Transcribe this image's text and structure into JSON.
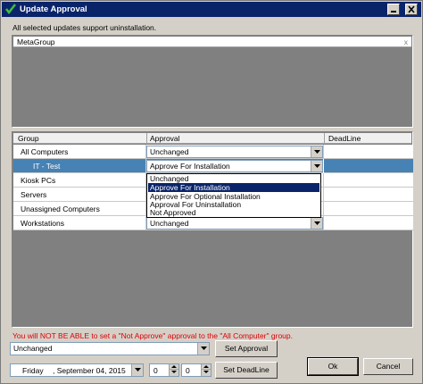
{
  "window": {
    "title": "Update Approval",
    "controls": [
      "minimize-icon",
      "close-icon"
    ]
  },
  "info_text": "All selected updates support uninstallation.",
  "metagroup": {
    "header": "MetaGroup",
    "close_glyph": "x"
  },
  "grid": {
    "columns": [
      "Group",
      "Approval",
      "DeadLine"
    ],
    "rows": [
      {
        "group": "All Computers",
        "approval": "Unchanged"
      },
      {
        "group": "IT - Test",
        "approval": "Approve For Installation",
        "selected": true
      },
      {
        "group": "Kiosk PCs",
        "approval": ""
      },
      {
        "group": "Servers",
        "approval": ""
      },
      {
        "group": "Unassigned Computers",
        "approval": ""
      },
      {
        "group": "Workstations",
        "approval": "Unchanged"
      }
    ],
    "dropdown_options": [
      "Unchanged",
      "Approve For Installation",
      "Approve For Optional Installation",
      "Approval For Uninstallation",
      "Not Approved"
    ],
    "dropdown_highlighted_index": 1
  },
  "warning_text": "You will NOT BE ABLE to set a \"Not Approve\" approval to the \"All Computer\" group.",
  "bottom": {
    "approval_combo_value": "Unchanged",
    "set_approval_label": "Set Approval",
    "date_day": "Friday",
    "date_value": ", September 04, 2015",
    "hour_value": "0",
    "minute_value": "0",
    "set_deadline_label": "Set DeadLine",
    "ok_label": "Ok",
    "cancel_label": "Cancel"
  },
  "colors": {
    "titlebar": "#0a246a",
    "selected_row": "#4682b4",
    "warning": "#e00000",
    "window_bg": "#d4d0c8"
  }
}
